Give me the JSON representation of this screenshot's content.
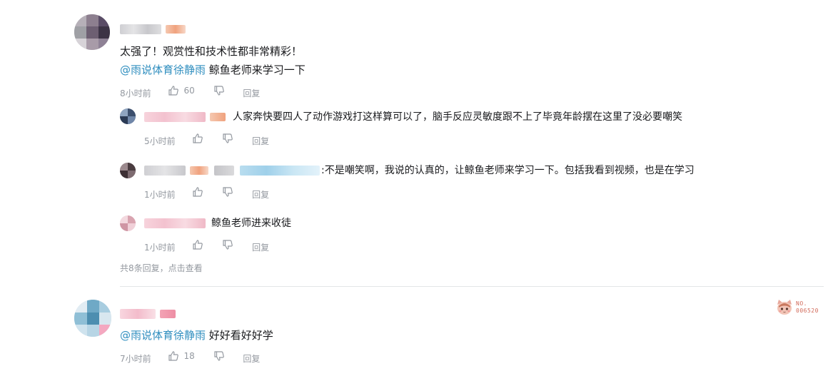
{
  "comments": [
    {
      "text": "太强了！观赏性和技术性都非常精彩！",
      "mention": "@雨说体育徐静雨",
      "mention_text": " 鲸鱼老师来学习一下",
      "time": "8小时前",
      "likes": "60",
      "reply_label": "回复"
    },
    {
      "mention": "@雨说体育徐静雨",
      "mention_text": " 好好看好好学",
      "time": "7小时前",
      "likes": "18",
      "reply_label": "回复",
      "medal_no": "NO.",
      "medal_num": "006520"
    }
  ],
  "replies": [
    {
      "text": "人家奔快要四人了动作游戏打这样算可以了，脑手反应灵敏度跟不上了毕竟年龄摆在这里了没必要嘲笑",
      "time": "5小时前",
      "reply_label": "回复"
    },
    {
      "text": ":不是嘲笑啊，我说的认真的，让鲸鱼老师来学习一下。包括我看到视频，也是在学习",
      "time": "1小时前",
      "reply_label": "回复"
    },
    {
      "text": "鲸鱼老师进来收徒",
      "time": "1小时前",
      "reply_label": "回复"
    }
  ],
  "more_replies": "共8条回复，点击查看",
  "colors": {
    "mention": "#2f8ebf",
    "meta": "#9499a0",
    "divider": "#e3e5e7"
  },
  "icons": {
    "like": "thumbs-up-icon",
    "dislike": "thumbs-down-icon"
  }
}
